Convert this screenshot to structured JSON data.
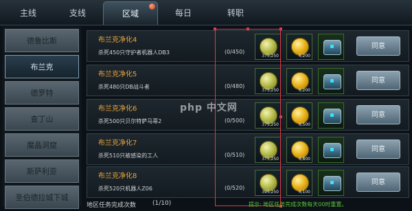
{
  "tabs": [
    {
      "label": "主线"
    },
    {
      "label": "支线"
    },
    {
      "label": "区域",
      "active": true
    },
    {
      "label": "每日"
    },
    {
      "label": "转职"
    }
  ],
  "sidebar": {
    "items": [
      {
        "label": "德鲁比斯"
      },
      {
        "label": "布兰克",
        "active": true
      },
      {
        "label": "德罗特"
      },
      {
        "label": "查丁山"
      },
      {
        "label": "魔晶洞窟"
      },
      {
        "label": "斯萨利亚"
      },
      {
        "label": "圣伯德拉城下城"
      }
    ]
  },
  "quests": [
    {
      "title": "布兰克净化4",
      "desc": "杀死450只守护者机器人DB3",
      "progress": "(0/450)",
      "rewards": [
        "375,250",
        "6,200",
        ""
      ],
      "button": "同意"
    },
    {
      "title": "布兰克净化5",
      "desc": "杀死480只DB战斗者",
      "progress": "(0/480)",
      "rewards": [
        "375,250",
        "6,200",
        ""
      ],
      "button": "同意"
    },
    {
      "title": "布兰克净化6",
      "desc": "杀死500只贝尔特萨马蒂2",
      "progress": "(0/500)",
      "rewards": [
        "375,250",
        "6,500",
        ""
      ],
      "button": "同意"
    },
    {
      "title": "布兰克净化7",
      "desc": "杀死510只被感染的工人",
      "progress": "(0/510)",
      "rewards": [
        "375,250",
        "6,800",
        ""
      ],
      "button": "同意"
    },
    {
      "title": "布兰克净化8",
      "desc": "杀死520只机器人Z06",
      "progress": "(0/520)",
      "rewards": [
        "395,250",
        "6,100",
        ""
      ],
      "button": "同意"
    }
  ],
  "footer": {
    "label": "地区任务完成次数",
    "count": "(1/10)",
    "tip": "提示: 地区任务完成次数每天00时重置。"
  },
  "watermark": "php 中文网",
  "colors": {
    "accent": "#e8a640",
    "tip": "#5ec43a",
    "highlight": "#e03a4a"
  }
}
